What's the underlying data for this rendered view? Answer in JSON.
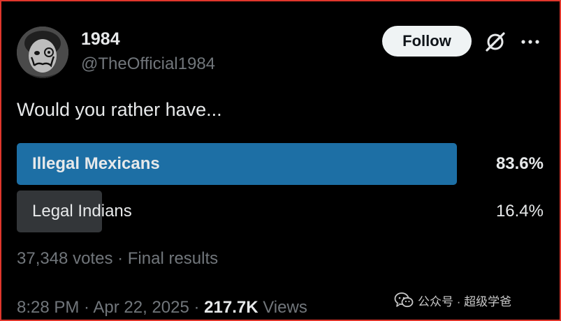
{
  "post": {
    "author": {
      "display_name": "1984",
      "handle": "@TheOfficial1984",
      "avatar": "dali-portrait-avatar"
    },
    "follow_label": "Follow",
    "icons": [
      "grok-icon",
      "more-icon"
    ],
    "text": "Would you rather have..."
  },
  "poll": {
    "options": [
      {
        "label": "Illegal Mexicans",
        "percent_text": "83.6%",
        "percent": 83.6,
        "winner": true
      },
      {
        "label": "Legal Indians",
        "percent_text": "16.4%",
        "percent": 16.4,
        "winner": false
      }
    ],
    "votes": "37,348 votes",
    "separator": " · ",
    "status": "Final results"
  },
  "meta": {
    "time": "8:28 PM",
    "date": "Apr 22, 2025",
    "separator": " · ",
    "views_count": "217.7K",
    "views_label": "Views"
  },
  "watermark": {
    "icon": "wechat-icon",
    "text": "公众号 · 超级学爸"
  },
  "colors": {
    "background": "#000000",
    "winner_bar": "#1d6fa5",
    "other_bar": "#333639",
    "secondary_text": "#71767b",
    "frame_border": "#e0362c"
  }
}
